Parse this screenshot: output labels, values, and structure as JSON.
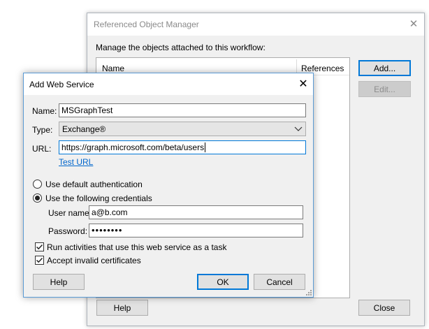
{
  "colors": {
    "accent": "#0078d7",
    "link": "#0066cc",
    "dialog_bg": "#f0f0f0",
    "stop_red": "#d9241c"
  },
  "background_window": {
    "title": "Referenced Object Manager",
    "description": "Manage the objects attached to this workflow:",
    "columns": [
      "Name",
      "References"
    ],
    "buttons": {
      "add": "Add...",
      "edit": "Edit...",
      "help": "Help",
      "close": "Close"
    },
    "close_icon": "close-icon"
  },
  "dialog": {
    "title": "Add Web Service",
    "name_label": "Name:",
    "name_value": "MSGraphTest",
    "type_label": "Type:",
    "type_value": "Exchange®",
    "url_label": "URL:",
    "url_value": "https://graph.microsoft.com/beta/users",
    "test_url": "Test URL",
    "auth_default": "Use default authentication",
    "auth_credentials": "Use the following credentials",
    "selected_auth": "credentials",
    "username_label": "User name:",
    "username_value": "a@b.com",
    "password_label": "Password:",
    "password_value": "••••••••",
    "run_as_task": "Run activities that use this web service as a task",
    "run_as_task_checked": true,
    "accept_invalid": "Accept invalid certificates",
    "accept_invalid_checked": true,
    "buttons": {
      "help": "Help",
      "ok": "OK",
      "cancel": "Cancel"
    }
  }
}
